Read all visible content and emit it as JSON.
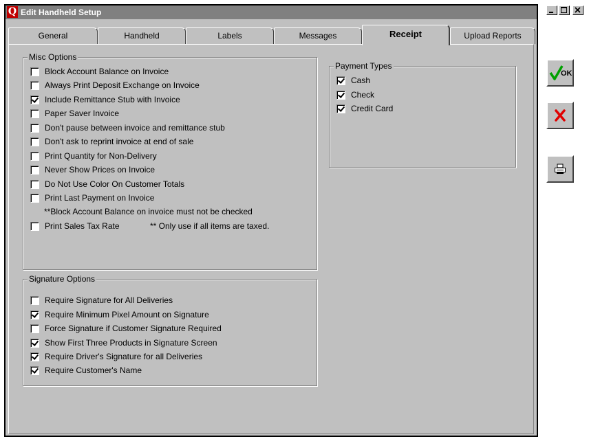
{
  "window": {
    "title": "Edit Handheld Setup",
    "logo": "Q"
  },
  "tabs": [
    {
      "label": "General"
    },
    {
      "label": "Handheld"
    },
    {
      "label": "Labels"
    },
    {
      "label": "Messages"
    },
    {
      "label": "Receipt"
    },
    {
      "label": "Upload Reports"
    }
  ],
  "misc": {
    "legend": "Misc Options",
    "items": [
      {
        "label": "Block Account Balance on Invoice",
        "checked": false
      },
      {
        "label": "Always Print Deposit Exchange on Invoice",
        "checked": false
      },
      {
        "label": "Include Remittance Stub with Invoice",
        "checked": true
      },
      {
        "label": "Paper Saver Invoice",
        "checked": false
      },
      {
        "label": "Don't pause between invoice and remittance stub",
        "checked": false
      },
      {
        "label": "Don't ask to reprint invoice at end of sale",
        "checked": false
      },
      {
        "label": "Print Quantity for Non-Delivery",
        "checked": false
      },
      {
        "label": "Never Show Prices on Invoice",
        "checked": false
      },
      {
        "label": "Do Not Use Color On Customer Totals",
        "checked": false
      },
      {
        "label": "Print Last Payment on Invoice",
        "checked": false
      }
    ],
    "note_last_payment": "**Block Account Balance on invoice must not be checked",
    "sales_tax": {
      "label": "Print Sales Tax Rate",
      "checked": false
    },
    "note_sales_tax": "** Only use if all items are taxed."
  },
  "signature": {
    "legend": "Signature Options",
    "items": [
      {
        "label": "Require Signature for All Deliveries",
        "checked": false
      },
      {
        "label": "Require Minimum Pixel Amount on Signature",
        "checked": true
      },
      {
        "label": "Force Signature if Customer Signature Required",
        "checked": false
      },
      {
        "label": "Show First Three Products in Signature Screen",
        "checked": true
      },
      {
        "label": "Require Driver's Signature for all Deliveries",
        "checked": true
      },
      {
        "label": "Require Customer's Name",
        "checked": true
      }
    ]
  },
  "payment": {
    "legend": "Payment Types",
    "items": [
      {
        "label": "Cash",
        "checked": true
      },
      {
        "label": "Check",
        "checked": true
      },
      {
        "label": "Credit Card",
        "checked": true
      }
    ]
  },
  "buttons": {
    "ok_label": "OK"
  }
}
